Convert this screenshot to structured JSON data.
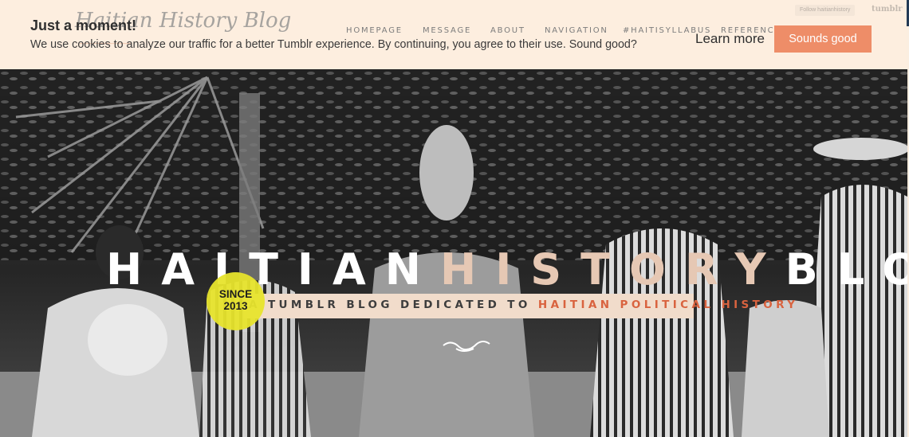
{
  "header": {
    "blog_title": "Haitian History Blog",
    "nav": [
      "HOMEPAGE",
      "MESSAGE",
      "ABOUT",
      "NAVIGATION",
      "#HAITISYLLABUS",
      "REFERENCE"
    ],
    "follow_button": "Follow haitianhistory",
    "tumblr_logo": "tumblr"
  },
  "cookie_banner": {
    "title": "Just a moment!",
    "text": "We use cookies to analyze our traffic for a better Tumblr experience. By continuing, you agree to their use. Sound good?",
    "learn_more": "Learn more",
    "accept": "Sounds good"
  },
  "hero": {
    "title_part1": "HAITIAN",
    "title_part2": "HISTORY",
    "title_part3": "BLOG",
    "since_line1": "SINCE",
    "since_line2": "2013",
    "tagline_plain": "A TUMBLR BLOG DEDICATED TO",
    "tagline_highlight": "HAITIAN POLITICAL HISTORY"
  },
  "colors": {
    "header_bg": "#fdeedf",
    "accent": "#ee8d68",
    "highlight_text": "#d9633f",
    "badge": "#e7e42c"
  }
}
